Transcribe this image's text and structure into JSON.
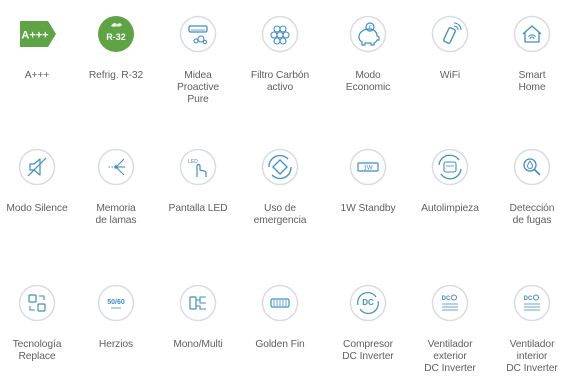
{
  "theme": {
    "green": "#5ea344",
    "blue": "#3f8ec5",
    "ring": "#d7dce3",
    "text": "#5f6164"
  },
  "features": [
    {
      "label": "A+++",
      "icon": "energy-label-icon",
      "badge": "A+++"
    },
    {
      "label": "Refrig. R-32",
      "icon": "refrigerant-r32-icon",
      "badge": "R-32"
    },
    {
      "label": "Midea\nProactive\nPure",
      "icon": "air-conditioner-icon"
    },
    {
      "label": "Filtro Carbón\nactivo",
      "icon": "carbon-filter-icon"
    },
    {
      "label": "Modo\nEconomic",
      "icon": "piggy-bank-icon"
    },
    {
      "label": "WiFi",
      "icon": "wifi-remote-icon"
    },
    {
      "label": "Smart\nHome",
      "icon": "smart-home-icon"
    },
    {
      "label": "Modo Silence",
      "icon": "speaker-mute-icon"
    },
    {
      "label": "Memoria\nde lamas",
      "icon": "louver-memory-icon"
    },
    {
      "label": "Pantalla LED",
      "icon": "led-display-touch-icon",
      "badge": "LED"
    },
    {
      "label": "Uso de\nemergencia",
      "icon": "emergency-mode-icon"
    },
    {
      "label": "1W Standby",
      "icon": "standby-1w-icon",
      "badge": "1W"
    },
    {
      "label": "Autolimpieza",
      "icon": "self-clean-icon"
    },
    {
      "label": "Detección\nde fugas",
      "icon": "leak-detection-icon"
    },
    {
      "label": "Tecnología\nReplace",
      "icon": "replace-technology-icon"
    },
    {
      "label": "Herzios",
      "icon": "hertz-icon",
      "badge": "50/60"
    },
    {
      "label": "Mono/Multi",
      "icon": "mono-multi-icon"
    },
    {
      "label": "Golden Fin",
      "icon": "golden-fin-icon"
    },
    {
      "label": "Compresor\nDC Inverter",
      "icon": "dc-compressor-icon",
      "badge": "DC"
    },
    {
      "label": "Ventilador\nexterior\nDC Inverter",
      "icon": "dc-fan-outdoor-icon",
      "badge": "DC"
    },
    {
      "label": "Ventilador\ninterior\nDC Inverter",
      "icon": "dc-fan-indoor-icon",
      "badge": "DC"
    }
  ]
}
